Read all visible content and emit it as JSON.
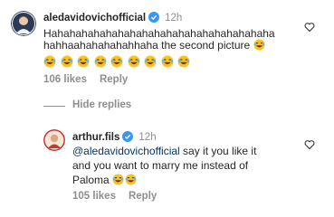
{
  "comment": {
    "username": "aledavidovichofficial",
    "time": "12h",
    "line1": "Hahahahahahahahahahahahahahahahahahaha",
    "line2": "hahhaahahahahahhaha the second picture",
    "emoji_count": 9,
    "likes": "106 likes",
    "reply_label": "Reply",
    "avatar_icon": "avatar-icon",
    "verified_icon": "verified-badge-icon"
  },
  "hide_replies_label": "Hide replies",
  "reply": {
    "username": "arthur.fils",
    "time": "12h",
    "mention": "@aledavidovichofficial",
    "line1_rest": " say it you like it",
    "line2": "and you want to marry me instead of",
    "line3": "Paloma",
    "likes": "105 likes",
    "reply_label": "Reply",
    "avatar_icon": "avatar-icon",
    "verified_icon": "verified-badge-icon"
  },
  "colors": {
    "text": "#262626",
    "muted": "#8e8e8e",
    "mention": "#00376b",
    "verified": "#3897f0"
  }
}
